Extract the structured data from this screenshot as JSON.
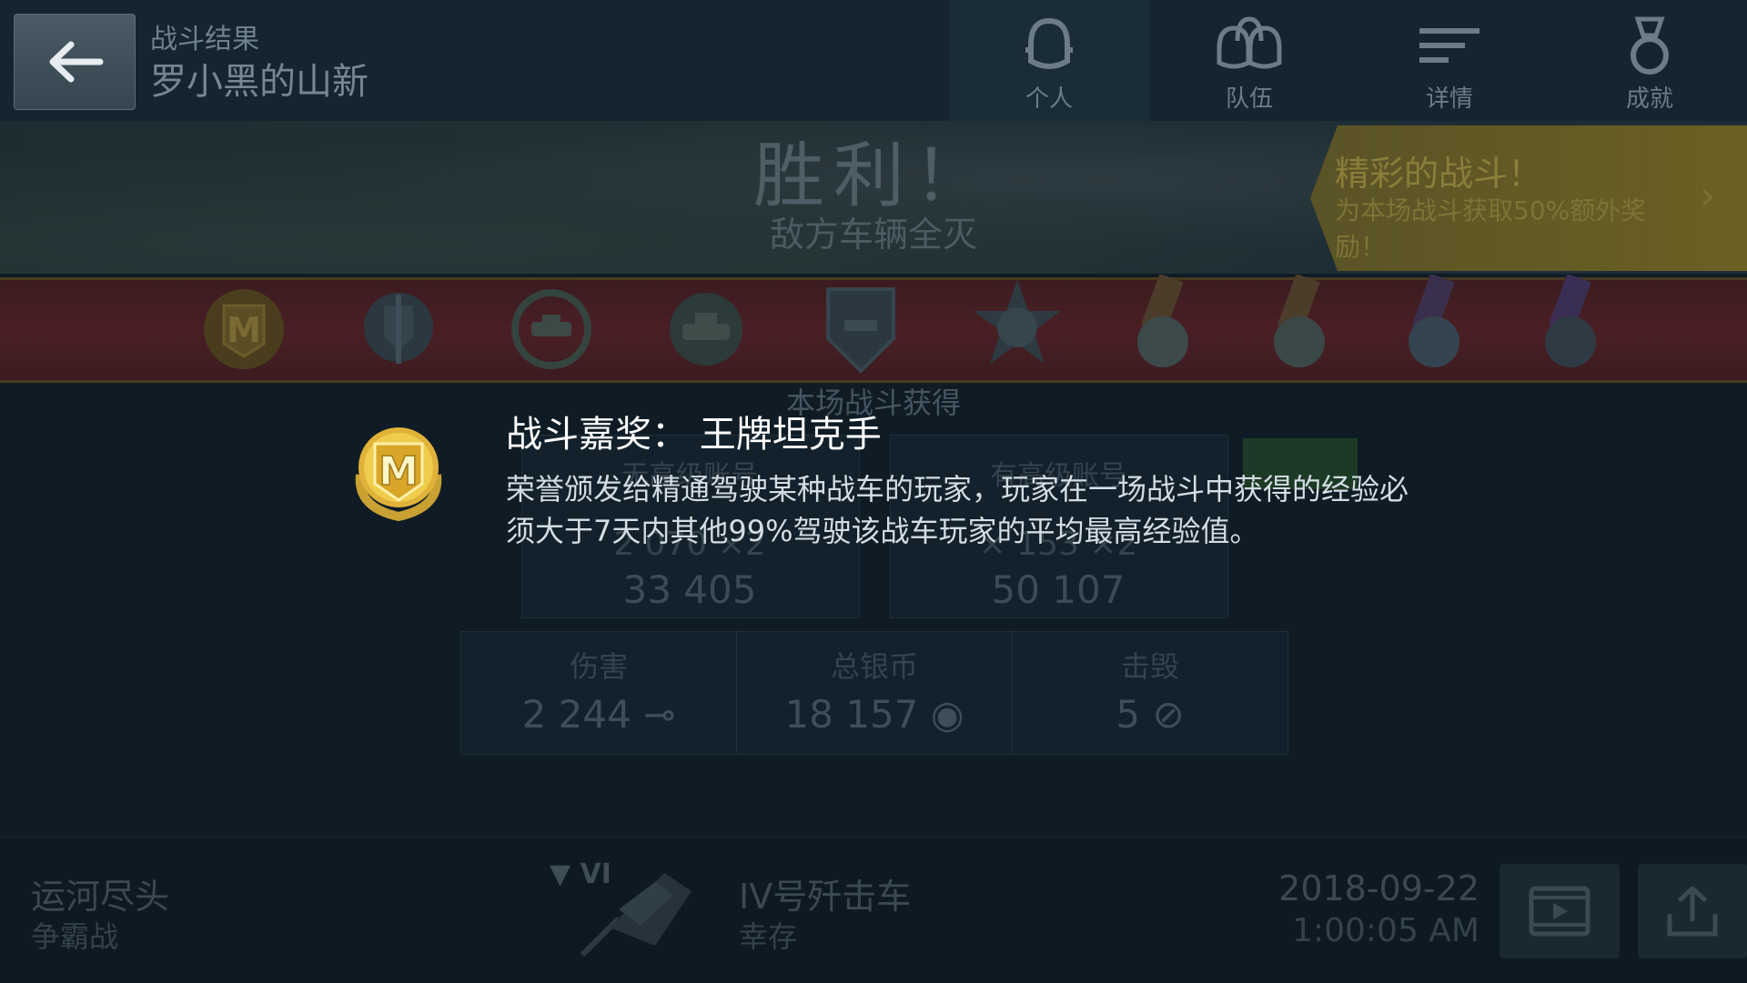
{
  "header": {
    "back_icon": "arrow-left-icon",
    "subtitle": "战斗结果",
    "title": "罗小黑的山新"
  },
  "tabs": [
    {
      "label": "个人",
      "icon": "single-helmet-icon",
      "active": true
    },
    {
      "label": "队伍",
      "icon": "team-helmets-icon",
      "active": false
    },
    {
      "label": "详情",
      "icon": "details-list-icon",
      "active": false
    },
    {
      "label": "成就",
      "icon": "achievement-medal-icon",
      "active": false
    }
  ],
  "banner": {
    "title": "胜利！",
    "subtitle": "敌方车辆全灭",
    "promo_title": "精彩的战斗！",
    "promo_desc": "为本场战斗获取50%额外奖励！"
  },
  "medals": [
    "mastery-badge",
    "sword-shield-medal",
    "tank-wreath-medal",
    "tank-emblem-medal",
    "shield-tank-medal",
    "hero-star-medal",
    "ribbon-medal-1",
    "ribbon-medal-2",
    "ribbon-medal-3",
    "ribbon-medal-4"
  ],
  "rewards": {
    "earned_label": "本场战斗获得",
    "standard_title": "无高级账号",
    "standard_xp": "2 070 ×2",
    "standard_silver": "33 405",
    "premium_title": "有高级账号",
    "premium_xp": "× 153 ×2",
    "premium_silver": "50 107"
  },
  "stats": [
    {
      "label": "伤害",
      "value": "2 244",
      "icon": "damage-shell-icon"
    },
    {
      "label": "总银币",
      "value": "18 157",
      "icon": "silver-coins-icon"
    },
    {
      "label": "击毁",
      "value": "5",
      "icon": "destroyed-tank-icon"
    }
  ],
  "award_popup": {
    "title": "战斗嘉奖：  王牌坦克手",
    "description": "荣誉颁发给精通驾驶某种战车的玩家，玩家在一场战斗中获得的经验必须大于7天内其他99%驾驶该战车玩家的平均最高经验值。",
    "icon": "ace-tanker-mastery-badge"
  },
  "footer": {
    "map": "运河尽头",
    "mode": "争霸战",
    "tank_tier": "▼ VI",
    "tank_name": "IV号歼击车",
    "tank_status": "幸存",
    "date": "2018-09-22",
    "time": "1:00:05 AM",
    "replay_icon": "replay-film-icon",
    "share_icon": "share-upload-icon"
  },
  "colors": {
    "background": "#0f1c25",
    "ribbon": "#4a1f24",
    "promo": "#6b6024",
    "gold": "#e0b23a"
  }
}
